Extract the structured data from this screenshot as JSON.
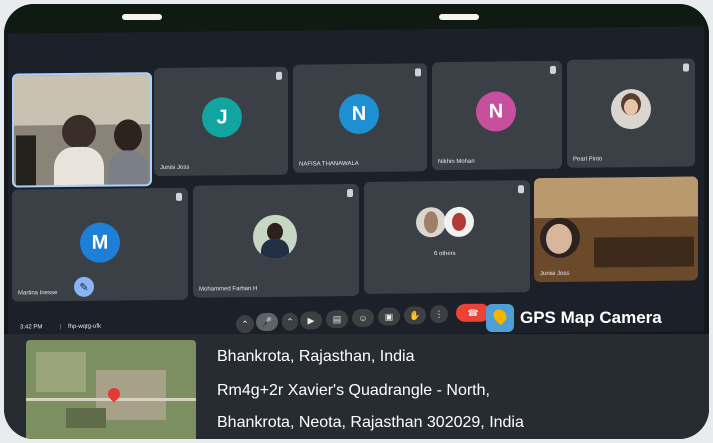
{
  "participants": [
    {
      "name": "",
      "type": "video-group"
    },
    {
      "name": "Junisi Joss",
      "initial": "J",
      "color": "#12a4a0"
    },
    {
      "name": "NAFISA THANAWALA",
      "initial": "N",
      "color": "#1f8fd4"
    },
    {
      "name": "Nikhin Mohan",
      "initial": "N",
      "color": "#c74f9d"
    },
    {
      "name": "Pearl Pinto",
      "type": "photo"
    },
    {
      "name": "Martina Inesse",
      "initial": "M",
      "color": "#1e7fd6"
    },
    {
      "name": "Mohammed Farhan.H",
      "type": "photo"
    },
    {
      "name": "6 others",
      "type": "others"
    },
    {
      "name": "Junisi Joss",
      "type": "video-self"
    }
  ],
  "meeting": {
    "time": "3:42 PM",
    "code": "fhp-wqtg-ufk"
  },
  "gps": {
    "brand": "GPS Map Camera"
  },
  "location": {
    "line1": "Bhankrota, Rajasthan, India",
    "line2": "Rm4g+2r Xavier's Quadrangle - North,",
    "line3": "Bhankrota, Neota, Rajasthan 302029, India"
  }
}
